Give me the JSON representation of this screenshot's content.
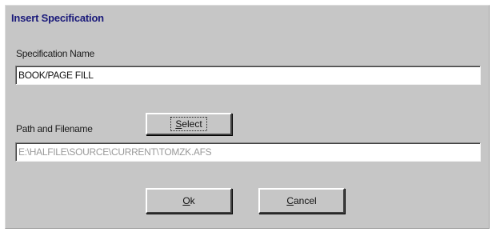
{
  "dialog": {
    "title": "Insert Specification",
    "spec_name_label": "Specification Name",
    "spec_name_value": "BOOK/PAGE FILL",
    "path_label": "Path and Filename",
    "path_value": "E:\\HALFILE\\SOURCE\\CURRENT\\TOMZK.AFS",
    "select_button": {
      "mnemonic": "S",
      "rest": "elect"
    },
    "ok_button": {
      "mnemonic": "O",
      "rest": "k"
    },
    "cancel_button": {
      "mnemonic": "C",
      "rest": "ancel"
    }
  }
}
